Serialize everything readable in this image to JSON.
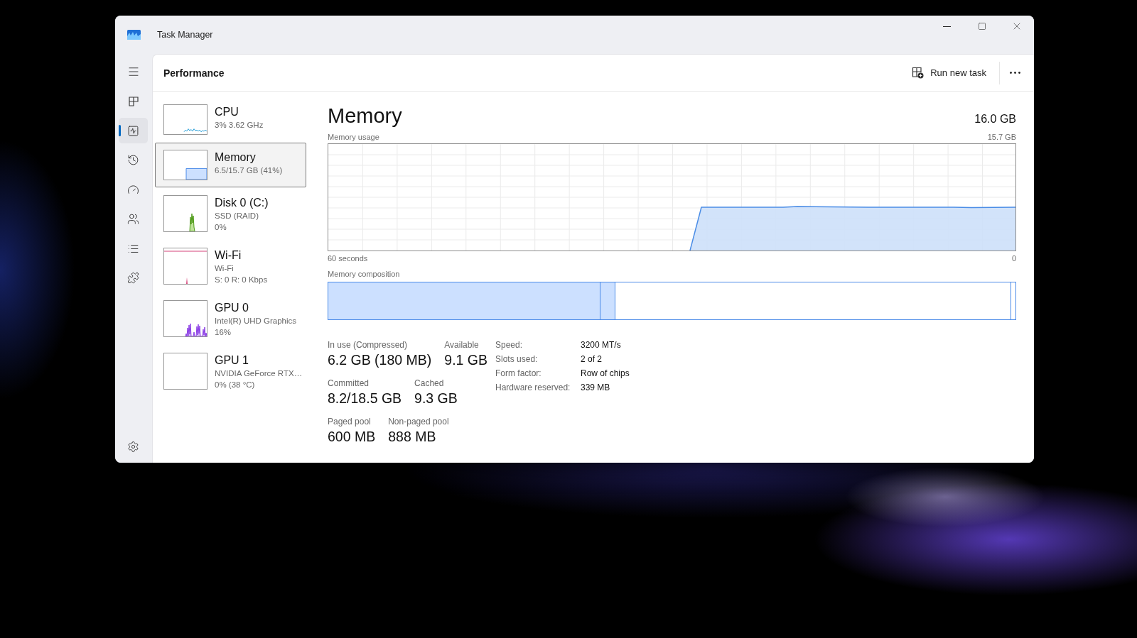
{
  "window": {
    "title": "Task Manager"
  },
  "nav": {
    "items": [
      {
        "kind": "tiles",
        "selected": false
      },
      {
        "kind": "activity",
        "selected": true
      },
      {
        "kind": "history",
        "selected": false
      },
      {
        "kind": "gauge",
        "selected": false
      },
      {
        "kind": "users",
        "selected": false
      },
      {
        "kind": "list",
        "selected": false
      },
      {
        "kind": "puzzle",
        "selected": false
      }
    ]
  },
  "header": {
    "title": "Performance",
    "run_new_task": "Run new task"
  },
  "devices": [
    {
      "kind": "cpu",
      "name": "CPU",
      "details": [
        "3% 3.62 GHz"
      ],
      "selected": false
    },
    {
      "kind": "memory",
      "name": "Memory",
      "details": [
        "6.5/15.7 GB (41%)"
      ],
      "selected": true
    },
    {
      "kind": "disk",
      "name": "Disk 0 (C:)",
      "details": [
        "SSD (RAID)",
        "0%"
      ],
      "selected": false
    },
    {
      "kind": "network",
      "name": "Wi-Fi",
      "details": [
        "Wi-Fi",
        "S: 0 R: 0 Kbps"
      ],
      "selected": false
    },
    {
      "kind": "gpu",
      "name": "GPU 0",
      "details": [
        "Intel(R) UHD Graphics",
        "16%"
      ],
      "selected": false
    },
    {
      "kind": "idle",
      "name": "GPU 1",
      "details": [
        "NVIDIA GeForce RTX…",
        "0% (38 °C)"
      ],
      "selected": false
    }
  ],
  "memory": {
    "title": "Memory",
    "total": "16.0 GB",
    "usage_label": "Memory usage",
    "usage_max": "15.7 GB",
    "time_start": "60 seconds",
    "time_end": "0",
    "composition_label": "Memory composition",
    "stats": [
      {
        "items": [
          {
            "label": "In use (Compressed)",
            "value": "6.2 GB (180 MB)"
          },
          {
            "label": "Available",
            "value": "9.1 GB"
          }
        ]
      },
      {
        "items": [
          {
            "label": "Committed",
            "value": "8.2/18.5 GB"
          },
          {
            "label": "Cached",
            "value": "9.3 GB"
          }
        ]
      },
      {
        "items": [
          {
            "label": "Paged pool",
            "value": "600 MB"
          },
          {
            "label": "Non-paged pool",
            "value": "888 MB"
          }
        ]
      }
    ],
    "specs": [
      {
        "label": "Speed:",
        "value": "3200 MT/s"
      },
      {
        "label": "Slots used:",
        "value": "2 of 2"
      },
      {
        "label": "Form factor:",
        "value": "Row of chips"
      },
      {
        "label": "Hardware reserved:",
        "value": "339 MB"
      }
    ]
  }
}
